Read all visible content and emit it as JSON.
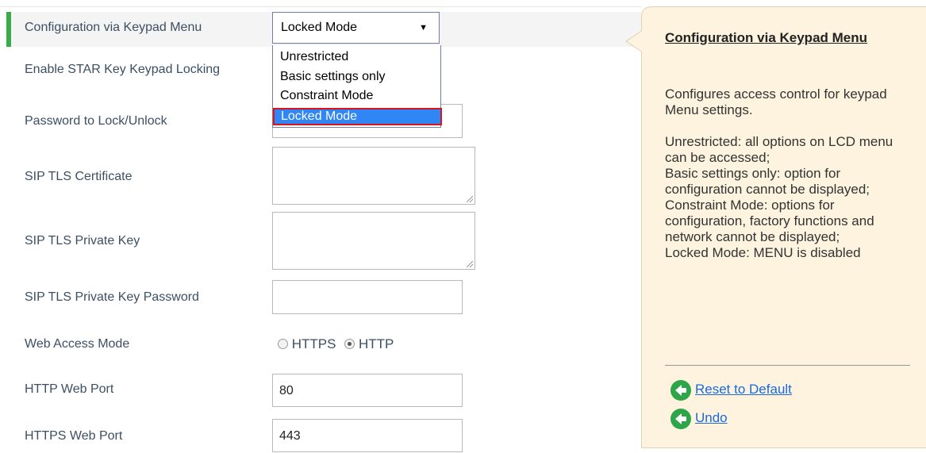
{
  "form": {
    "rows": [
      {
        "label": "Configuration via Keypad Menu"
      },
      {
        "label": "Enable STAR Key Keypad Locking"
      },
      {
        "label": "Password to Lock/Unlock"
      },
      {
        "label": "SIP TLS Certificate"
      },
      {
        "label": "SIP TLS Private Key"
      },
      {
        "label": "SIP TLS Private Key Password"
      },
      {
        "label": "Web Access Mode"
      },
      {
        "label": "HTTP Web Port"
      },
      {
        "label": "HTTPS Web Port"
      }
    ],
    "keypad_select": {
      "value": "Locked Mode",
      "options": [
        "Unrestricted",
        "Basic settings only",
        "Constraint Mode",
        "Locked Mode"
      ]
    },
    "web_access": {
      "option1": "HTTPS",
      "option2": "HTTP",
      "selected": "HTTP"
    },
    "http_port": "80",
    "https_port": "443"
  },
  "help": {
    "title": "Configuration via Keypad Menu",
    "body": "Configures access control for keypad Menu settings.\n\nUnrestricted: all options on LCD menu can be accessed;\nBasic settings only: option for configuration cannot be displayed;\nConstraint Mode: options for configuration, factory functions and network cannot be displayed;\nLocked Mode: MENU is disabled",
    "reset_label": "Reset to Default",
    "undo_label": "Undo"
  },
  "colors": {
    "accent_bar": "#3aaa4b",
    "selected_option": "#2f86f4",
    "highlight_border": "#d9141d",
    "help_bg": "#fdf3de",
    "link": "#1a6ae0"
  }
}
